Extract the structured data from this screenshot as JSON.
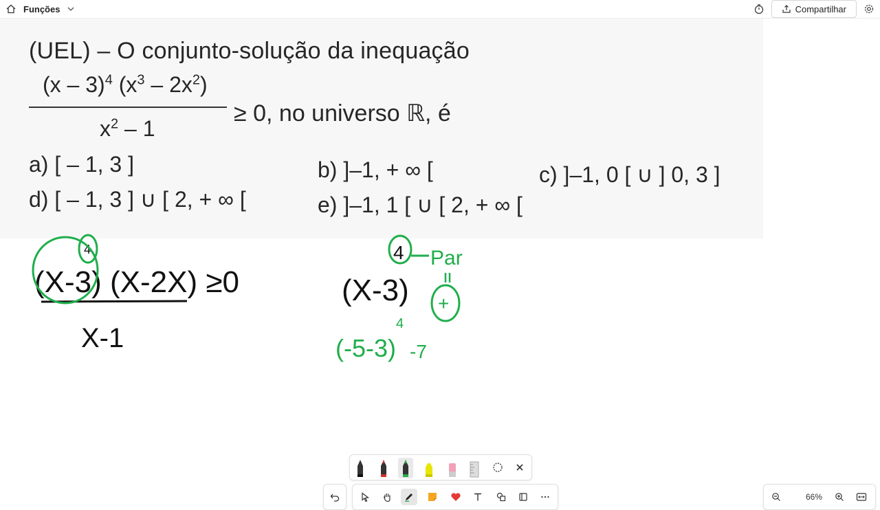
{
  "header": {
    "title": "Funções",
    "share_label": "Compartilhar"
  },
  "problem": {
    "intro": "(UEL) – O conjunto-solução da inequação",
    "numerator": "(x – 3)",
    "numerator_exp": "4",
    "numerator_rest": " (x",
    "numerator_exp2": "3",
    "numerator_rest2": " – 2x",
    "numerator_exp3": "2",
    "numerator_end": ")",
    "denominator": "x",
    "denominator_exp": "2",
    "denominator_end": " – 1",
    "tail": "≥ 0, no universo ℝ, é",
    "options": {
      "a": "a)   [ – 1, 3 ]",
      "b": "b)   ]–1, + ∞ [",
      "c": "c)   ]–1, 0 [ ∪ ] 0, 3 ]",
      "d": "d)   [ – 1, 3 ] ∪ [ 2, + ∞ [",
      "e": "e)   ]–1, 1 [ ∪ [ 2, + ∞ ["
    }
  },
  "annotations": {
    "left_numerator": "(X-3) (X-2X) ≥0",
    "left_den": "X-1",
    "exp_four": "4",
    "middle_expr": "(X-3)",
    "middle_test": "(-5-3)",
    "middle_result": "-7",
    "par_label": "Par",
    "plus_sign": "+"
  },
  "zoom": {
    "level": "66%"
  },
  "colors": {
    "ink_black": "#111111",
    "ink_green": "#1fae4b",
    "problem_bg": "#f7f7f7"
  }
}
